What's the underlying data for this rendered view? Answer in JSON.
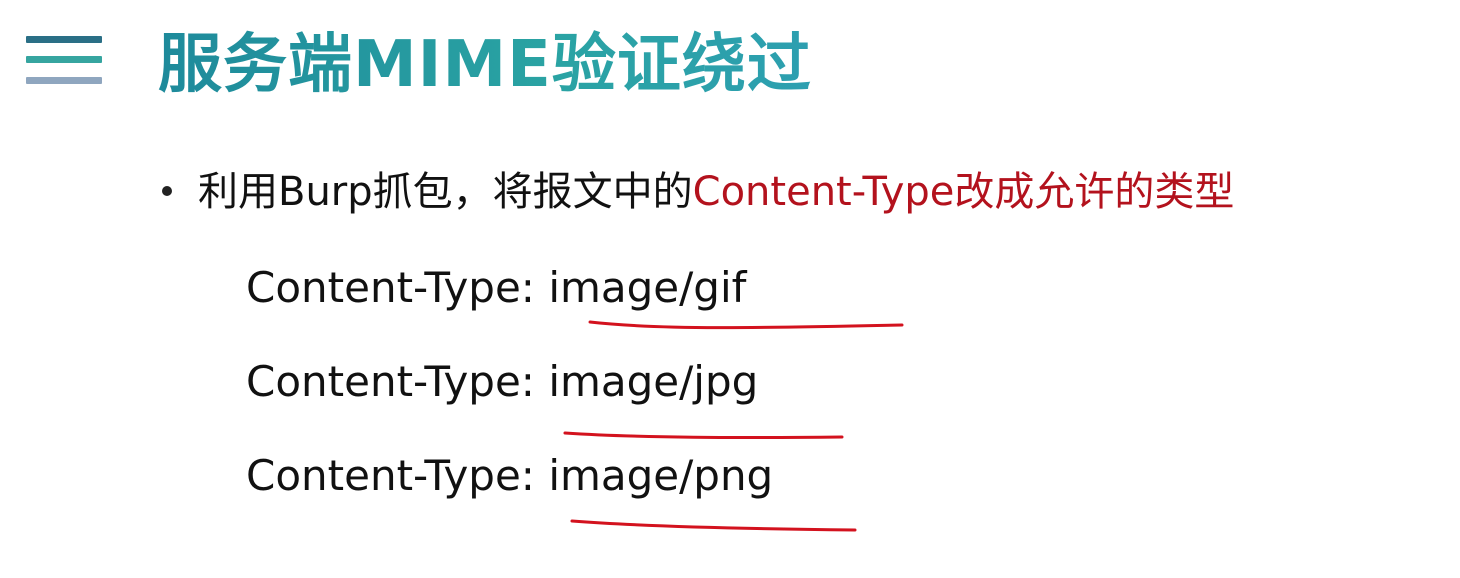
{
  "slide": {
    "title": "服务端MIME验证绕过",
    "bullet": {
      "text_before": "利用Burp抓包，将报文中的",
      "text_highlight": "Content-Type改成允许的类型"
    },
    "content_type_lines": [
      {
        "label": "Content-Type: ",
        "value": "image/gif"
      },
      {
        "label": "Content-Type: ",
        "value": "image/jpg"
      },
      {
        "label": "Content-Type: ",
        "value": "image/png"
      }
    ]
  },
  "colors": {
    "title_teal": "#1f8f9c",
    "highlight_red": "#b3121d",
    "underline_red": "#d3121e",
    "menu_bar_1": "#2a6f86",
    "menu_bar_2": "#36a5a0",
    "menu_bar_3": "#8fa6bf"
  },
  "icons": {
    "menu": "hamburger-menu-icon"
  }
}
